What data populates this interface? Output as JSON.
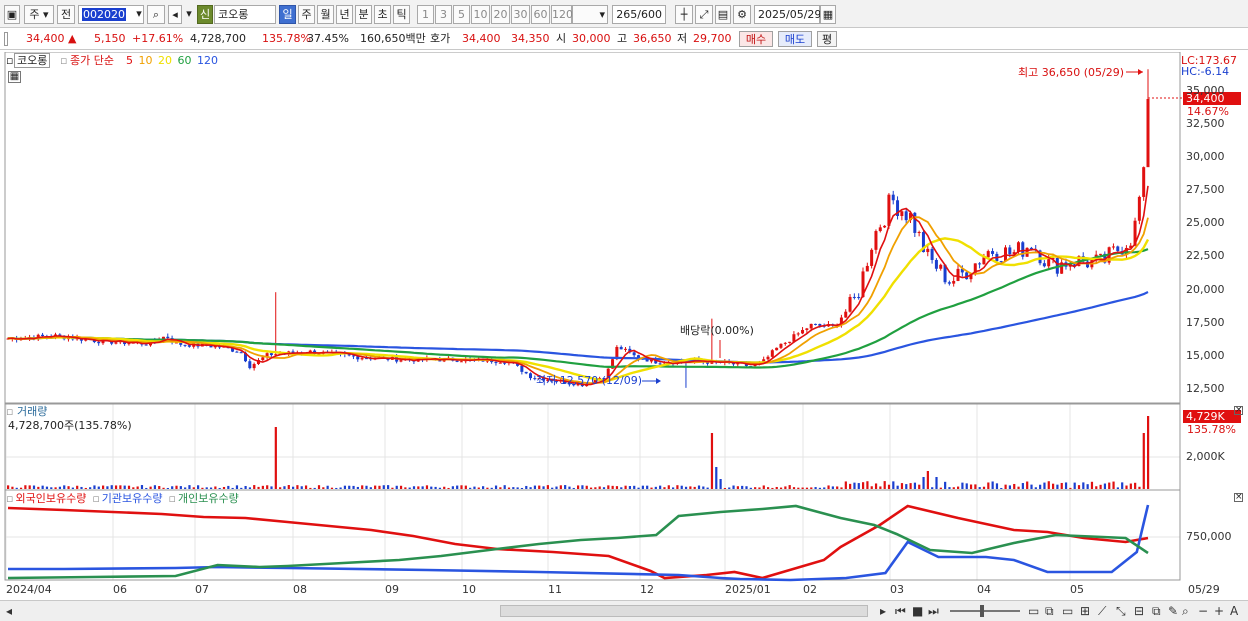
{
  "toolbar": {
    "market": "주",
    "prev": "전",
    "code": "002020",
    "badge": "신",
    "name": "코오롱",
    "periods": [
      "일",
      "주",
      "월",
      "년",
      "분",
      "초",
      "틱"
    ],
    "intervals": [
      "1",
      "3",
      "5",
      "10",
      "20",
      "30",
      "60",
      "120"
    ],
    "count": "265",
    "count_max": "/600",
    "date": "2025/05/29"
  },
  "infobar": {
    "price": "34,400",
    "change_sign": "▲",
    "change": "5,150",
    "change_pct": "+17.61%",
    "volume": "4,728,700",
    "vol_ratio": "135.78%",
    "turnover": "37.45%",
    "amount": "160,650백만",
    "ask_label": "호가",
    "ask": "34,400",
    "bid": "34,350",
    "open_label": "시",
    "open": "30,000",
    "high_label": "고",
    "high": "36,650",
    "low_label": "저",
    "low": "29,700",
    "buy": "매수",
    "sell": "매도",
    "eval": "평"
  },
  "price_panel": {
    "name_box": "코오롱",
    "legend_label": "종가 단순",
    "ma": [
      {
        "period": "5",
        "color": "#e01010"
      },
      {
        "period": "10",
        "color": "#f0a000"
      },
      {
        "period": "20",
        "color": "#f0e000"
      },
      {
        "period": "60",
        "color": "#20a040"
      },
      {
        "period": "120",
        "color": "#2a55e0"
      }
    ],
    "high_annotation": "최고 36,650 (05/29)",
    "low_annotation": "최저 12,570 (12/09)",
    "dividend_annotation": "배당락(0.00%)",
    "lc": "LC:173.67",
    "hc": "HC:-6.14",
    "current_price": "34,400",
    "current_pct": "14.67%",
    "y_labels": [
      "35,000",
      "32,500",
      "30,000",
      "27,500",
      "25,000",
      "22,500",
      "20,000",
      "17,500",
      "15,000",
      "12,500"
    ]
  },
  "volume_panel": {
    "title": "거래량",
    "value": "4,728,700주(135.78%)",
    "current": "4,729K",
    "pct": "135.78%",
    "y_label": "2,000K"
  },
  "holding_panel": {
    "series": [
      {
        "name": "외국인보유수량",
        "color": "#e01010"
      },
      {
        "name": "기관보유수량",
        "color": "#2a55e0"
      },
      {
        "name": "개인보유수량",
        "color": "#2a9050"
      }
    ],
    "y_label": "750,000"
  },
  "x_axis": {
    "labels": [
      "2024/04",
      "06",
      "07",
      "08",
      "09",
      "10",
      "11",
      "12",
      "2025/01",
      "02",
      "03",
      "04",
      "05"
    ],
    "last": "05/29"
  },
  "chart_data": {
    "type": "line",
    "x_dates": [
      "2024/04",
      "2024/06",
      "2024/07",
      "2024/08",
      "2024/09",
      "2024/10",
      "2024/11",
      "2024/12",
      "2025/01",
      "2025/02",
      "2025/03",
      "2025/04",
      "2025/05",
      "2025/05/29"
    ],
    "close": [
      16300,
      16400,
      16000,
      15400,
      15200,
      14800,
      14600,
      13000,
      14600,
      14100,
      17000,
      21500,
      22300,
      34400
    ],
    "series": [
      {
        "name": "5",
        "values": [
          16300,
          16400,
          16000,
          15300,
          15200,
          14800,
          14700,
          13300,
          14600,
          14200,
          17200,
          21000,
          22400,
          27500
        ]
      },
      {
        "name": "120",
        "values": [
          16800,
          16700,
          16600,
          16400,
          16100,
          15800,
          15500,
          15100,
          14400,
          14100,
          14800,
          16500,
          17600,
          18800
        ]
      }
    ],
    "volume": {
      "last": 4728700
    },
    "ylim": [
      11500,
      37500
    ],
    "annotations": {
      "high": 36650,
      "low": 12570
    }
  }
}
